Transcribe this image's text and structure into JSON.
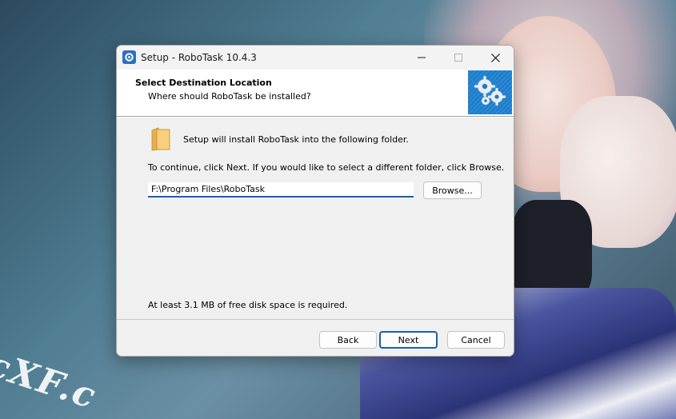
{
  "desktop": {
    "watermark": "cXF.c"
  },
  "window": {
    "title": "Setup - RoboTask 10.4.3",
    "icon": "robotask-app-icon"
  },
  "titlebar": {
    "minimize_icon": "minimize-icon",
    "maximize_icon": "maximize-icon",
    "close_icon": "close-icon"
  },
  "header": {
    "title": "Select Destination Location",
    "subtitle": "Where should RoboTask be installed?",
    "image": "gears-icon"
  },
  "content": {
    "intro": "Setup will install RoboTask into the following folder.",
    "continue_text": "To continue, click Next. If you would like to select a different folder, click Browse.",
    "path_value": "F:\\Program Files\\RoboTask",
    "browse_label": "Browse...",
    "disk_space": "At least 3.1 MB of free disk space is required."
  },
  "footer": {
    "back_label": "Back",
    "next_label": "Next",
    "cancel_label": "Cancel"
  },
  "colors": {
    "accent": "#1a5fb4",
    "header_image_blue": "#1f7bc8",
    "folder": "#f0c060"
  }
}
